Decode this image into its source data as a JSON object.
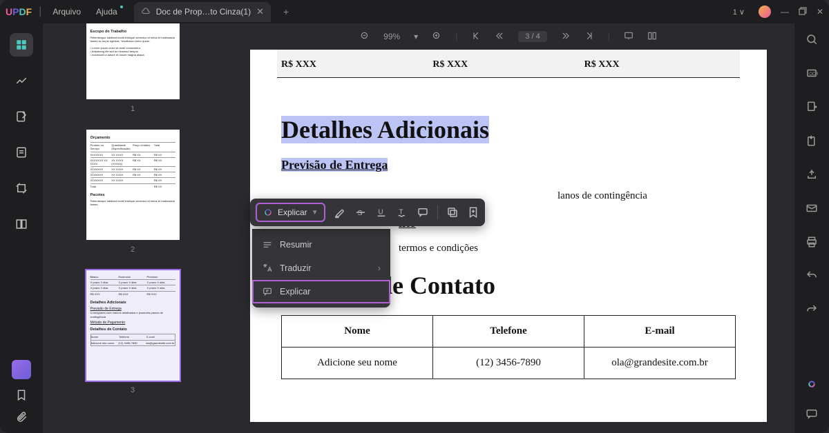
{
  "app": {
    "logo": "UPDF"
  },
  "menu": {
    "arquivo": "Arquivo",
    "ajuda": "Ajuda"
  },
  "tab": {
    "title": "Doc de Prop…to Cinza(1)"
  },
  "title_right": {
    "tag": "1 ∨"
  },
  "toolbar": {
    "zoom": "99%",
    "page": "3 / 4"
  },
  "thumbs": {
    "p1": {
      "num": "1",
      "t1": "Escopo do Trabalho"
    },
    "p2": {
      "num": "2",
      "t1": "Orçamento",
      "t2": "Pacotes"
    },
    "p3": {
      "num": "3",
      "t1": "Detalhes Adicionais",
      "t2": "Previsão de Entrega",
      "t3": "Detalhes de Contato"
    }
  },
  "page": {
    "price1": "R$ XXX",
    "price2": "R$ XXX",
    "price3": "R$ XXX",
    "h1": "Detalhes Adicionais",
    "h2": "Previsão de Entrega",
    "line1_partial": "lanos de contingência",
    "h2b_partial": "nto",
    "line2_partial": "termos e condições",
    "h1b_partial": "de Contato",
    "contact": {
      "head1": "Nome",
      "head2": "Telefone",
      "head3": "E-mail",
      "val1": "Adicione seu nome",
      "val2": "(12) 3456-7890",
      "val3": "ola@grandesite.com.br"
    }
  },
  "floatbar": {
    "explain": "Explicar"
  },
  "dropdown": {
    "resumir": "Resumir",
    "traduzir": "Traduzir",
    "explicar": "Explicar"
  }
}
